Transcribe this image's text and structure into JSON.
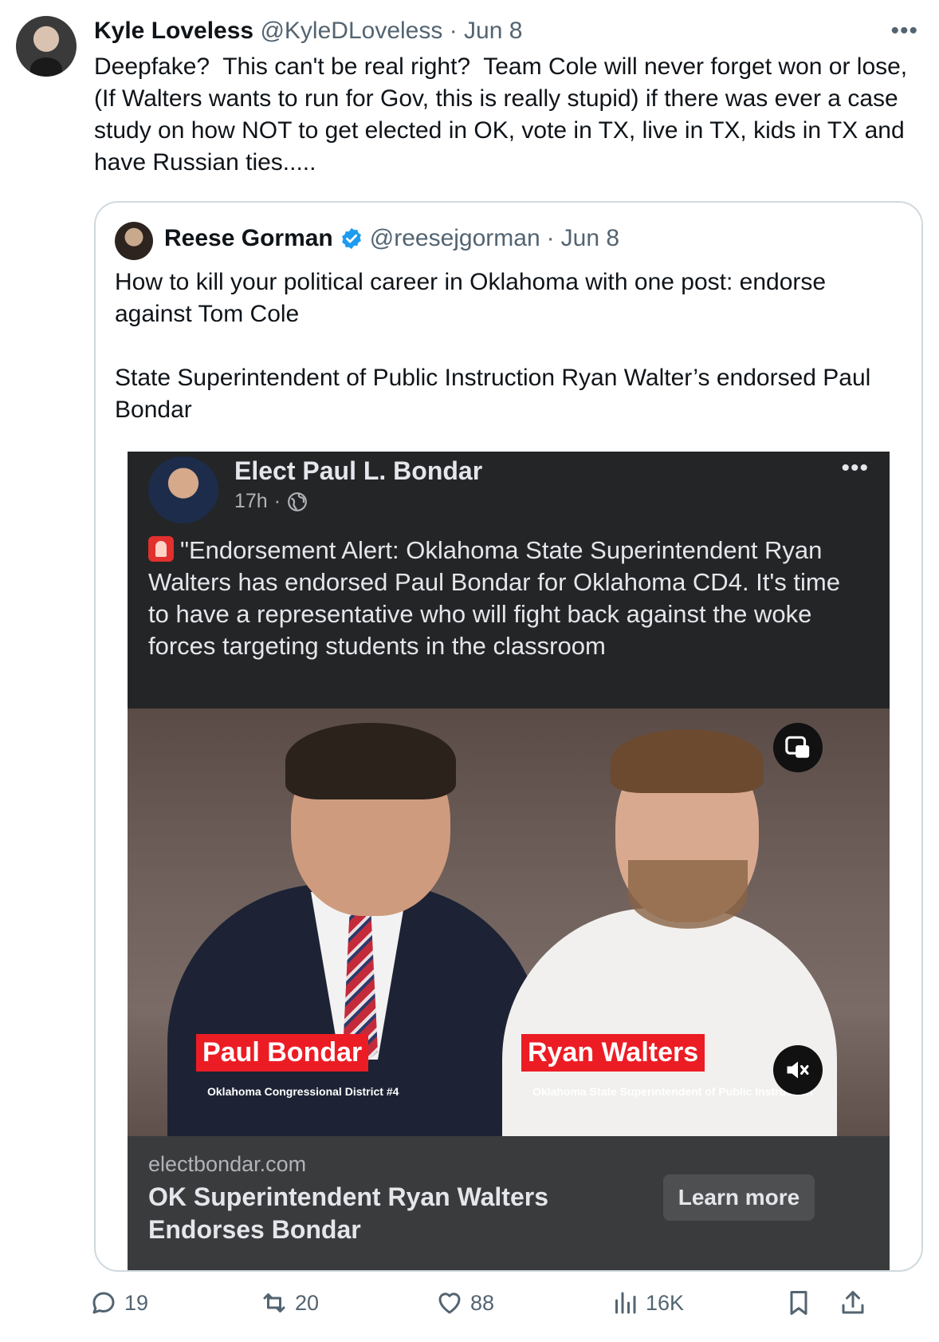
{
  "tweet": {
    "author_name": "Kyle Loveless",
    "author_handle": "@KyleDLoveless",
    "separator": "·",
    "date": "Jun 8",
    "more": "•••",
    "text": "Deepfake?  This can't be real right?  Team Cole will never forget won or lose, (If Walters wants to run for Gov, this is really stupid) if there was ever a case study on how NOT to get elected in OK, vote in TX, live in TX, kids in TX and have Russian ties....."
  },
  "quote": {
    "author_name": "Reese Gorman",
    "author_handle": "@reesejgorman",
    "separator": "·",
    "date": "Jun 8",
    "text": "How to kill your political career in Oklahoma with one post: endorse against Tom Cole\n\nState Superintendent of Public Instruction Ryan Walter’s endorsed Paul Bondar"
  },
  "fb_post": {
    "page_name": "Elect Paul L. Bondar",
    "time": "17h",
    "dot": "·",
    "more": "•••",
    "text": "\"Endorsement Alert: Oklahoma State Superintendent Ryan Walters has endorsed Paul Bondar for Oklahoma CD4. It's time to have a representative who will fight back against the woke forces targeting students in the classroom",
    "video": {
      "left_name": "Paul Bondar",
      "left_sub": "Oklahoma Congressional District #4",
      "right_name": "Ryan Walters",
      "right_sub": "Oklahoma State Superintendent of Public Instruction"
    },
    "link": {
      "domain": "electbondar.com",
      "title": "OK Superintendent Ryan Walters Endorses Bondar",
      "button": "Learn more"
    }
  },
  "actions": {
    "replies": "19",
    "reposts": "20",
    "likes": "88",
    "views": "16K"
  },
  "colors": {
    "muted": "#536471",
    "verified": "#1d9bf0",
    "fb_bg": "#242526",
    "label_red": "#ec1c24"
  }
}
